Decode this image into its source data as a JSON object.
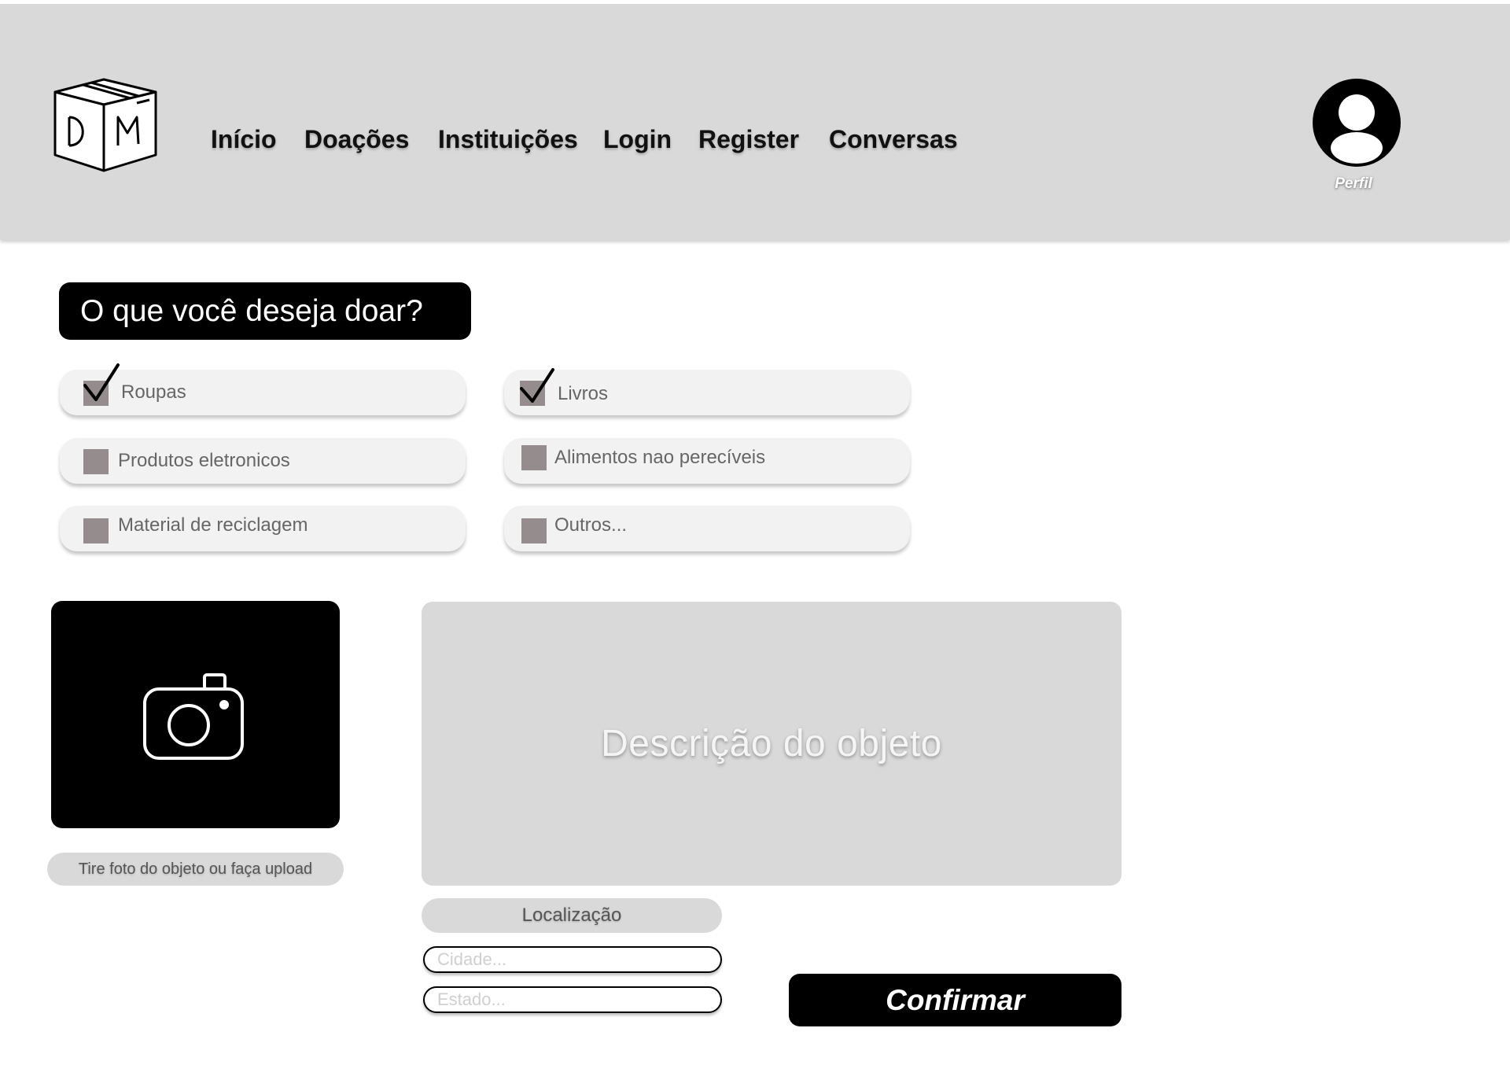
{
  "header": {
    "logo": {
      "letters": "D M"
    },
    "nav": [
      "Início",
      "Doações",
      "Instituições",
      "Login",
      "Register",
      "Conversas"
    ],
    "profile_label": "Perfil"
  },
  "form": {
    "question": "O que você deseja doar?",
    "options": [
      {
        "label": "Roupas",
        "checked": true
      },
      {
        "label": "Livros",
        "checked": true
      },
      {
        "label": "Produtos eletronicos",
        "checked": false
      },
      {
        "label": "Alimentos nao perecíveis",
        "checked": false
      },
      {
        "label": "Material de reciclagem",
        "checked": false
      },
      {
        "label": "Outros...",
        "checked": false
      }
    ],
    "photo_caption": "Tire foto do objeto ou faça upload",
    "description_placeholder": "Descrição do objeto",
    "location_label": "Localização",
    "city_placeholder": "Cidade...",
    "state_placeholder": "Estado...",
    "confirm_label": "Confirmar"
  },
  "icons": {
    "logo": "box-logo-icon",
    "profile": "user-avatar-icon",
    "photo": "camera-icon",
    "checked": "checkmark-icon"
  },
  "colors": {
    "header_bg": "#d9d9d9",
    "primary": "#000000",
    "checkbox": "#958d8d",
    "option_bg": "#f2f2f2"
  }
}
